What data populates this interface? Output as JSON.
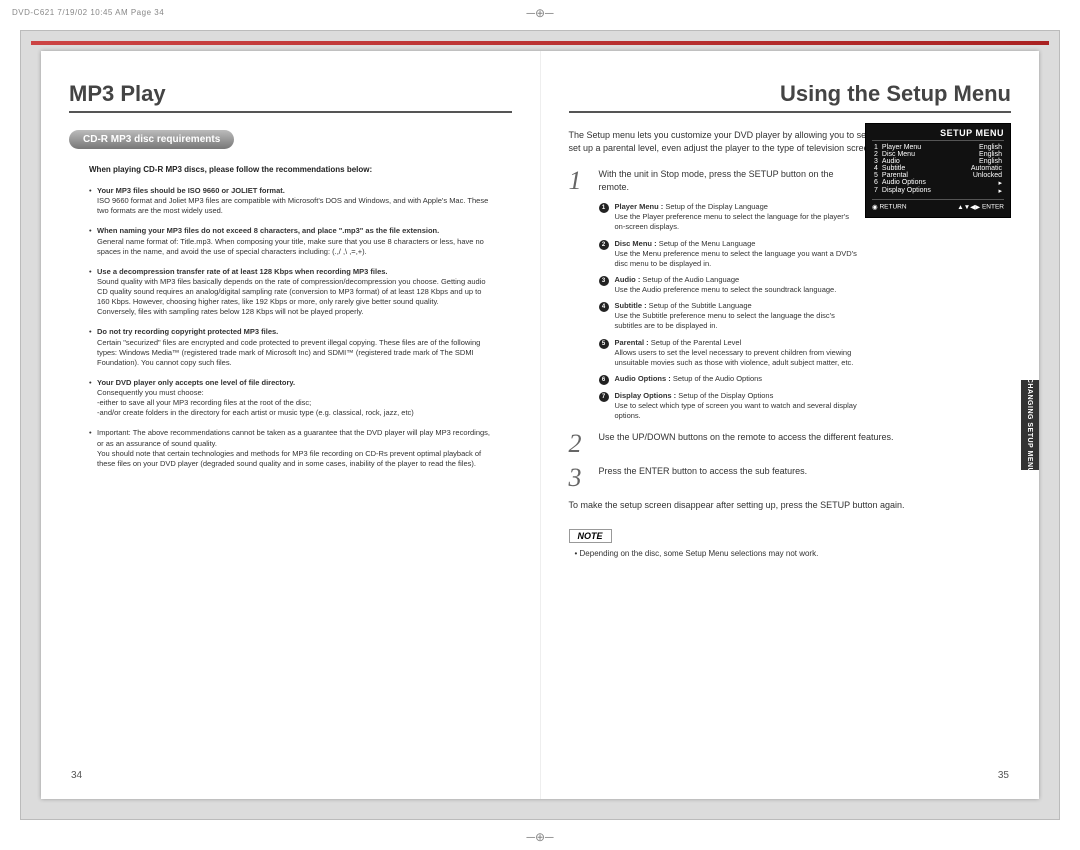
{
  "print_header": "DVD-C621  7/19/02 10:45 AM  Page 34",
  "left": {
    "title": "MP3 Play",
    "pill": "CD-R MP3 disc requirements",
    "sub": "When playing CD-R MP3 discs, please follow the recommendations below:",
    "bullets": [
      {
        "head": "Your MP3 files should be ISO 9660 or JOLIET format.",
        "body": "ISO 9660 format and Joliet MP3 files are compatible with Microsoft's DOS and Windows, and with Apple's Mac. These two formats are the most widely used."
      },
      {
        "head": "When naming your MP3 files do not exceed 8 characters, and place \".mp3\" as the file extension.",
        "body": "General name format of: Title.mp3. When composing your title, make sure that you use 8 characters or less, have no spaces in the name, and avoid the use of special characters including: (.,/ ,\\ ,=,+)."
      },
      {
        "head": "Use a decompression transfer rate of at least 128 Kbps when recording MP3 files.",
        "body": "Sound quality with MP3 files basically depends on the rate of compression/decompression you choose. Getting audio CD quality sound requires an analog/digital sampling rate (conversion to MP3 format) of at least 128 Kbps and up to 160 Kbps. However, choosing higher rates, like 192 Kbps or more, only rarely give better sound quality.\nConversely, files with sampling rates below 128 Kbps will not be played properly."
      },
      {
        "head": "Do not try recording copyright protected MP3 files.",
        "body": "Certain \"securized\" files are encrypted and code protected to prevent illegal copying. These files are of the following types: Windows Media™ (registered trade mark of Microsoft Inc) and SDMI™ (registered trade mark of The SDMI Foundation). You cannot copy such files."
      },
      {
        "head": "Your DVD player only accepts one level of file directory.",
        "body": "Consequently you must choose:\n-either to save all your MP3 recording files at the root of the disc;\n-and/or create folders in the directory for each artist or music type (e.g. classical, rock, jazz, etc)"
      },
      {
        "head": "",
        "body": "Important: The above recommendations cannot be taken as a guarantee that the DVD player will play MP3 recordings, or as an assurance of sound quality.\nYou should note that certain technologies and methods for MP3 file recording on CD-Rs prevent optimal playback of these files on your DVD player (degraded sound quality and in some cases, inability of the player to read the files)."
      }
    ],
    "page_num": "34"
  },
  "right": {
    "title": "Using the Setup Menu",
    "intro": "The Setup menu lets you customize your DVD player by allowing you to select various language preferences, set up a parental level, even adjust the player to the type of television screen you have.",
    "steps": [
      {
        "num": "1",
        "text": "With the unit in Stop mode, press the SETUP button on the remote."
      },
      {
        "num": "2",
        "text": "Use the UP/DOWN buttons on the remote to access the different features."
      },
      {
        "num": "3",
        "text": "Press the ENTER button to access the sub features."
      }
    ],
    "defs": [
      {
        "n": "1",
        "name": "Player Menu :",
        "title": "Setup of the Display Language",
        "body": "Use the Player preference menu to select the language for the player's on-screen displays."
      },
      {
        "n": "2",
        "name": "Disc Menu :",
        "title": "Setup of the Menu Language",
        "body": "Use the Menu preference menu to select the language you want a DVD's disc menu to be displayed in."
      },
      {
        "n": "3",
        "name": "Audio :",
        "title": "Setup of the Audio Language",
        "body": "Use the Audio preference menu to select the soundtrack language."
      },
      {
        "n": "4",
        "name": "Subtitle :",
        "title": "Setup of the Subtitle Language",
        "body": "Use the Subtitle preference menu to select the language the disc's subtitles are to be displayed in."
      },
      {
        "n": "5",
        "name": "Parental :",
        "title": "Setup of the Parental Level",
        "body": "Allows users to set the level necessary to prevent children from viewing unsuitable movies such as those with violence, adult subject matter, etc."
      },
      {
        "n": "6",
        "name": "Audio Options :",
        "title": "Setup of the Audio Options",
        "body": ""
      },
      {
        "n": "7",
        "name": "Display Options :",
        "title": "Setup of the Display Options",
        "body": "Use to select which type of screen you want to watch and several display options."
      }
    ],
    "footnote": "To make the setup screen disappear after setting up, press the SETUP button again.",
    "note_label": "NOTE",
    "note_text": "• Depending on the disc, some Setup Menu selections may not work.",
    "osd": {
      "title": "SETUP MENU",
      "rows": [
        {
          "n": "1",
          "label": "Player Menu",
          "value": "English"
        },
        {
          "n": "2",
          "label": "Disc Menu",
          "value": "English"
        },
        {
          "n": "3",
          "label": "Audio",
          "value": "English"
        },
        {
          "n": "4",
          "label": "Subtitle",
          "value": "Automatic"
        },
        {
          "n": "5",
          "label": "Parental",
          "value": "Unlocked"
        },
        {
          "n": "6",
          "label": "Audio Options",
          "value": "▸"
        },
        {
          "n": "7",
          "label": "Display Options",
          "value": "▸"
        }
      ],
      "foot_left": "RETURN",
      "foot_right": "ENTER"
    },
    "page_num": "35",
    "side_tab": "CHANGING SETUP MENU"
  }
}
